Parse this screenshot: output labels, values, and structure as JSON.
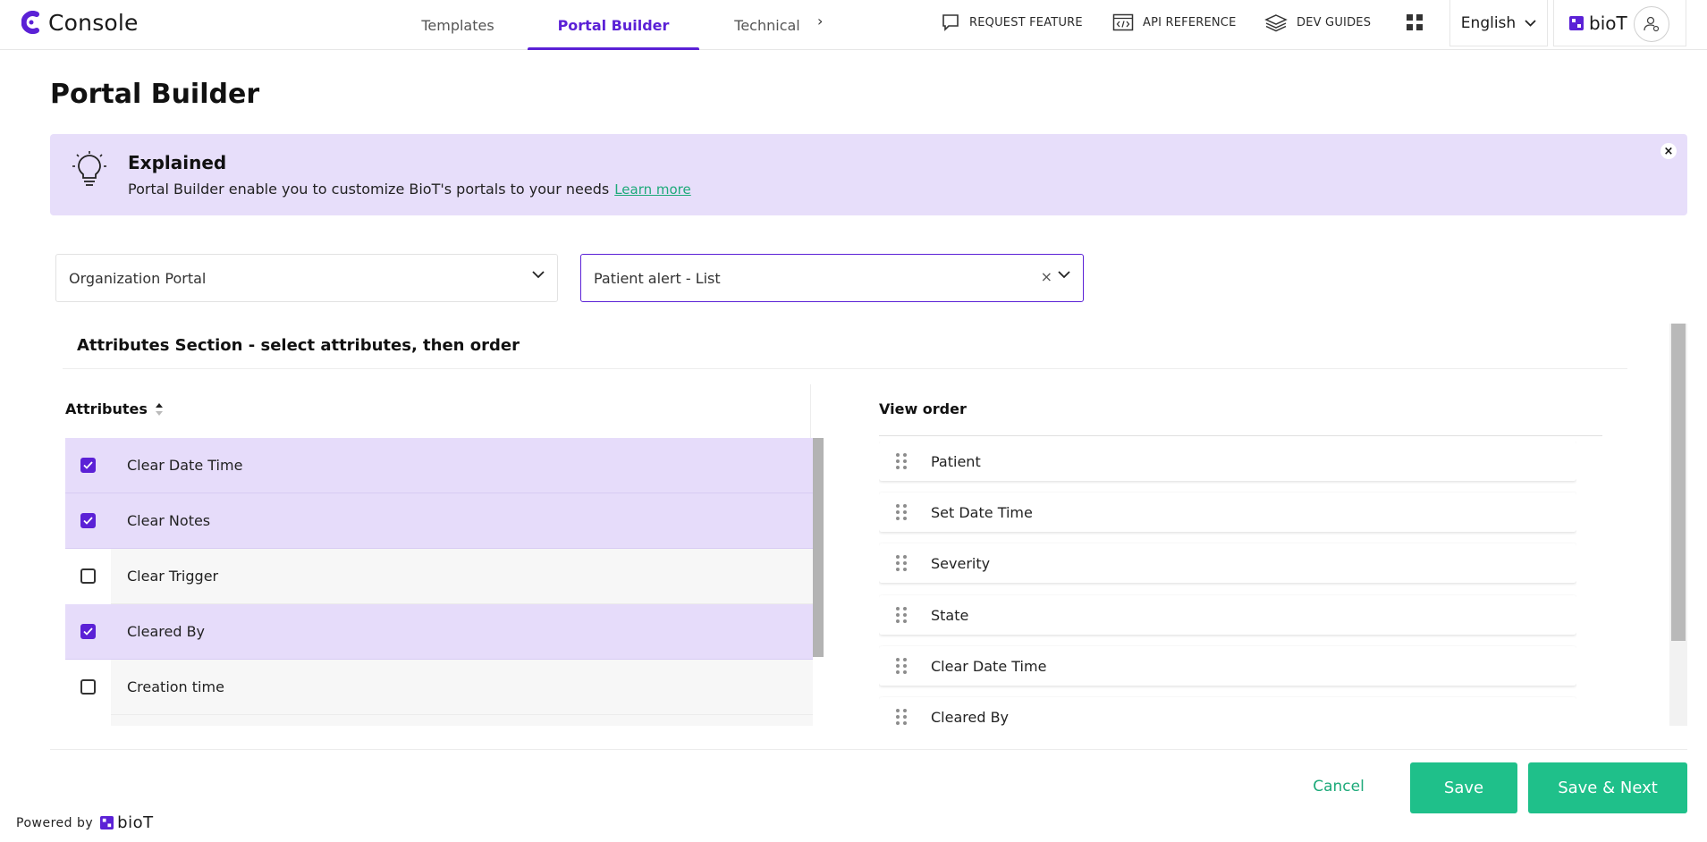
{
  "app": {
    "title": "Console"
  },
  "nav": {
    "tabs": [
      {
        "label": "Templates",
        "active": false
      },
      {
        "label": "Portal Builder",
        "active": true
      },
      {
        "label": "Technical",
        "active": false
      }
    ],
    "more_icon": "chevron-right-icon"
  },
  "toolbar": {
    "request_feature": "REQUEST FEATURE",
    "api_reference": "API REFERENCE",
    "dev_guides": "DEV GUIDES",
    "language": "English",
    "brand": "bioT"
  },
  "page": {
    "title": "Portal Builder"
  },
  "banner": {
    "title": "Explained",
    "text": "Portal Builder enable you to customize BioT's portals to your needs",
    "link": "Learn more"
  },
  "filters": {
    "portal": "Organization Portal",
    "view": "Patient alert - List"
  },
  "section": {
    "title": "Attributes Section - select attributes, then order"
  },
  "attributes": {
    "header": "Attributes",
    "items": [
      {
        "label": "Clear Date Time",
        "checked": true
      },
      {
        "label": "Clear Notes",
        "checked": true
      },
      {
        "label": "Clear Trigger",
        "checked": false
      },
      {
        "label": "Cleared By",
        "checked": true
      },
      {
        "label": "Creation time",
        "checked": false
      }
    ]
  },
  "view_order": {
    "header": "View order",
    "items": [
      "Patient",
      "Set Date Time",
      "Severity",
      "State",
      "Clear Date Time",
      "Cleared By"
    ]
  },
  "footer": {
    "cancel": "Cancel",
    "save": "Save",
    "save_next": "Save & Next",
    "powered_by": "Powered by",
    "brand": "bioT"
  },
  "colors": {
    "accent": "#5b21d6",
    "banner_bg": "#e7defa",
    "selected_row": "#e6dcfa",
    "primary_button": "#1fc08a",
    "link": "#1eaa7a"
  }
}
